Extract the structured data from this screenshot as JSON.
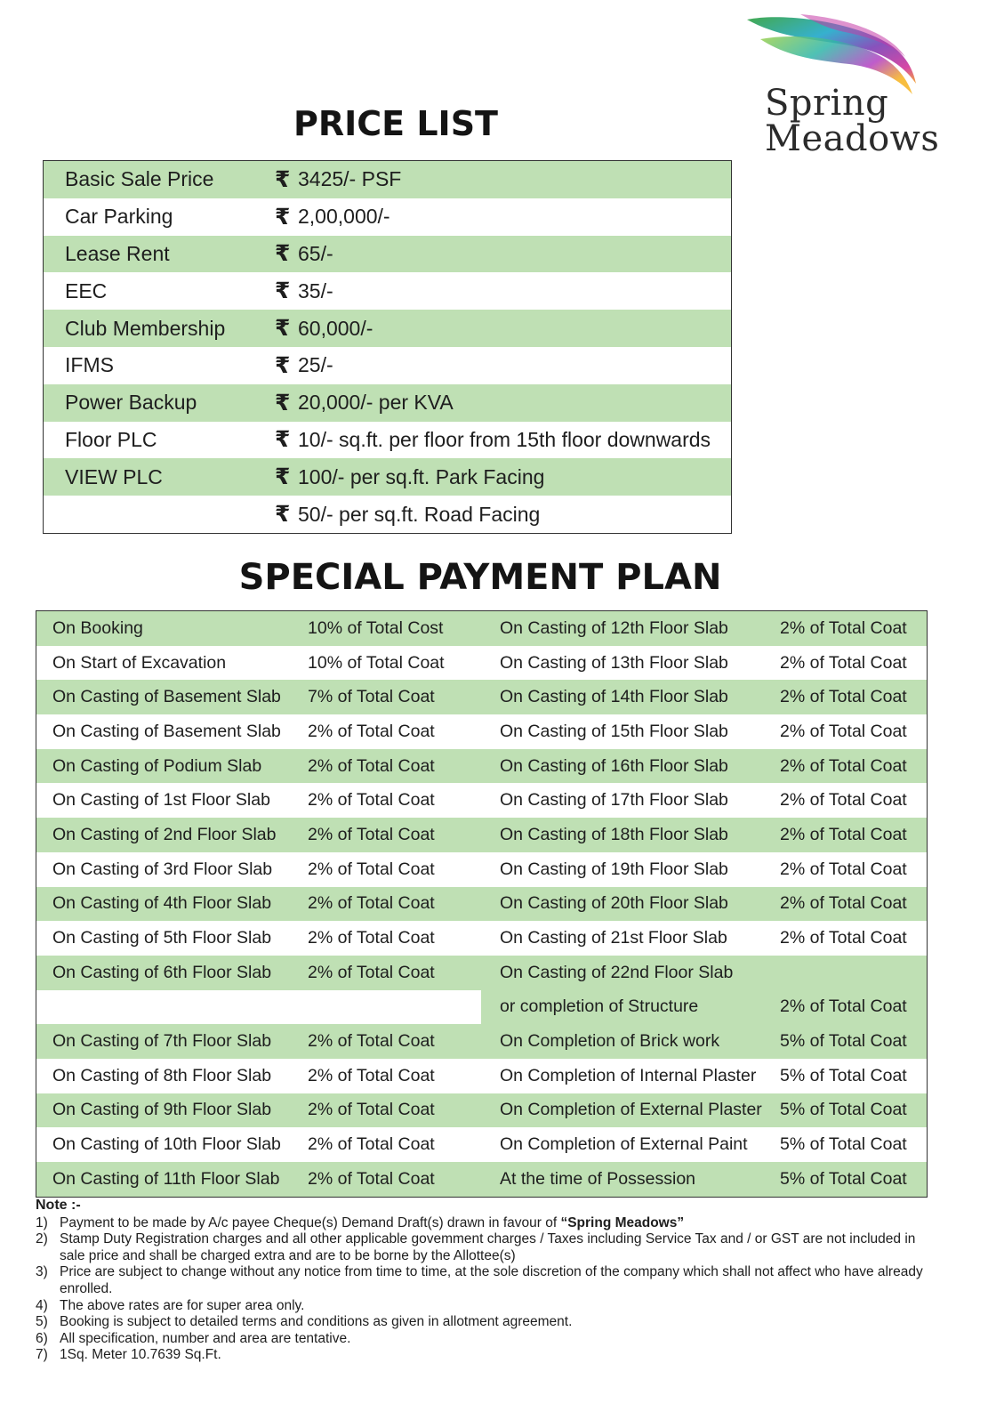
{
  "brand": {
    "line1": "Spring",
    "line2": "Meadows"
  },
  "price_list": {
    "title": "PRICE LIST",
    "currency_symbol": "₹",
    "rows": [
      {
        "label": "Basic Sale Price",
        "value": "3425/- PSF"
      },
      {
        "label": "Car Parking",
        "value": "2,00,000/-"
      },
      {
        "label": "Lease Rent",
        "value": "65/-"
      },
      {
        "label": "EEC",
        "value": "35/-"
      },
      {
        "label": "Club Membership",
        "value": "60,000/-"
      },
      {
        "label": "IFMS",
        "value": "25/-"
      },
      {
        "label": "Power Backup",
        "value": "20,000/- per KVA"
      },
      {
        "label": "Floor PLC",
        "value": "10/- sq.ft. per floor from 15th floor downwards"
      },
      {
        "label": "VIEW PLC",
        "value": "100/- per sq.ft. Park Facing"
      },
      {
        "label": "",
        "value": "50/- per sq.ft. Road Facing"
      }
    ]
  },
  "payment_plan": {
    "title": "SPECIAL PAYMENT PLAN",
    "rows": [
      {
        "stage_left": "On Booking",
        "amount_left": "10% of Total Cost",
        "stage_right": "On Casting of 12th Floor Slab",
        "amount_right": "2% of Total Coat"
      },
      {
        "stage_left": "On Start of Excavation",
        "amount_left": "10% of Total Coat",
        "stage_right": "On Casting of 13th Floor Slab",
        "amount_right": "2% of Total Coat"
      },
      {
        "stage_left": "On Casting of Basement Slab",
        "amount_left": "7% of Total Coat",
        "stage_right": "On Casting of 14th Floor Slab",
        "amount_right": "2% of Total Coat"
      },
      {
        "stage_left": "On Casting of Basement Slab",
        "amount_left": "2% of Total Coat",
        "stage_right": "On Casting of 15th Floor Slab",
        "amount_right": "2% of Total Coat"
      },
      {
        "stage_left": "On Casting of Podium Slab",
        "amount_left": "2% of Total Coat",
        "stage_right": "On Casting of 16th Floor Slab",
        "amount_right": "2% of Total Coat"
      },
      {
        "stage_left": "On Casting of 1st Floor Slab",
        "amount_left": "2% of Total Coat",
        "stage_right": "On Casting of 17th Floor Slab",
        "amount_right": "2% of Total Coat"
      },
      {
        "stage_left": "On Casting of 2nd Floor Slab",
        "amount_left": "2% of Total Coat",
        "stage_right": "On Casting of 18th Floor Slab",
        "amount_right": "2% of Total Coat"
      },
      {
        "stage_left": "On Casting of 3rd Floor Slab",
        "amount_left": "2% of Total Coat",
        "stage_right": "On Casting of 19th Floor Slab",
        "amount_right": "2% of Total Coat"
      },
      {
        "stage_left": "On Casting of 4th Floor Slab",
        "amount_left": "2% of Total Coat",
        "stage_right": "On Casting of 20th Floor Slab",
        "amount_right": "2% of Total Coat"
      },
      {
        "stage_left": "On Casting of 5th Floor Slab",
        "amount_left": "2% of Total Coat",
        "stage_right": "On Casting of 21st Floor Slab",
        "amount_right": "2% of Total Coat"
      },
      {
        "stage_left": "On Casting of 6th Floor Slab",
        "amount_left": "2% of Total Coat",
        "stage_right": "On Casting of 22nd Floor Slab",
        "amount_right": ""
      },
      {
        "stage_left": "",
        "amount_left": "",
        "stage_right": "or completion of Structure",
        "amount_right": "2% of Total Coat"
      },
      {
        "stage_left": "On Casting of 7th Floor Slab",
        "amount_left": "2% of Total Coat",
        "stage_right": "On Completion of Brick work",
        "amount_right": "5% of Total Coat"
      },
      {
        "stage_left": "On Casting of 8th Floor Slab",
        "amount_left": "2% of Total Coat",
        "stage_right": "On Completion of Internal Plaster",
        "amount_right": "5% of Total Coat"
      },
      {
        "stage_left": "On Casting of 9th Floor Slab",
        "amount_left": "2% of Total Coat",
        "stage_right": "On Completion of External Plaster",
        "amount_right": "5% of Total Coat"
      },
      {
        "stage_left": "On Casting of 10th Floor Slab",
        "amount_left": "2% of Total Coat",
        "stage_right": "On Completion of External Paint",
        "amount_right": "5% of Total Coat"
      },
      {
        "stage_left": "On Casting of 11th Floor Slab",
        "amount_left": "2% of Total Coat",
        "stage_right": "At the time of Possession",
        "amount_right": "5% of Total Coat"
      }
    ]
  },
  "notes": {
    "title": "Note :-",
    "items": [
      {
        "num": "1)",
        "text": "Payment to be made by A/c payee Cheque(s) Demand Draft(s) drawn in favour of ",
        "bold": "“Spring Meadows”"
      },
      {
        "num": "2)",
        "text": "Stamp Duty Registration charges and all other applicable govemment charges / Taxes including Service Tax and / or GST are not included in sale price and shall be charged extra and are to be borne by the Allottee(s)"
      },
      {
        "num": "3)",
        "text": "Price are subject to change without any notice from time to time, at the sole discretion of the company which shall not affect who have already enrolled."
      },
      {
        "num": "4)",
        "text": "The above rates are for super area only."
      },
      {
        "num": "5)",
        "text": "Booking is subject to detailed terms and conditions as given in allotment agreement."
      },
      {
        "num": "6)",
        "text": "All specification, number and area are tentative."
      },
      {
        "num": "7)",
        "text": "1Sq. Meter 10.7639 Sq.Ft."
      }
    ]
  },
  "colors": {
    "row_green": "#bfe0b4",
    "border": "#333333",
    "text": "#1e1e1e"
  }
}
